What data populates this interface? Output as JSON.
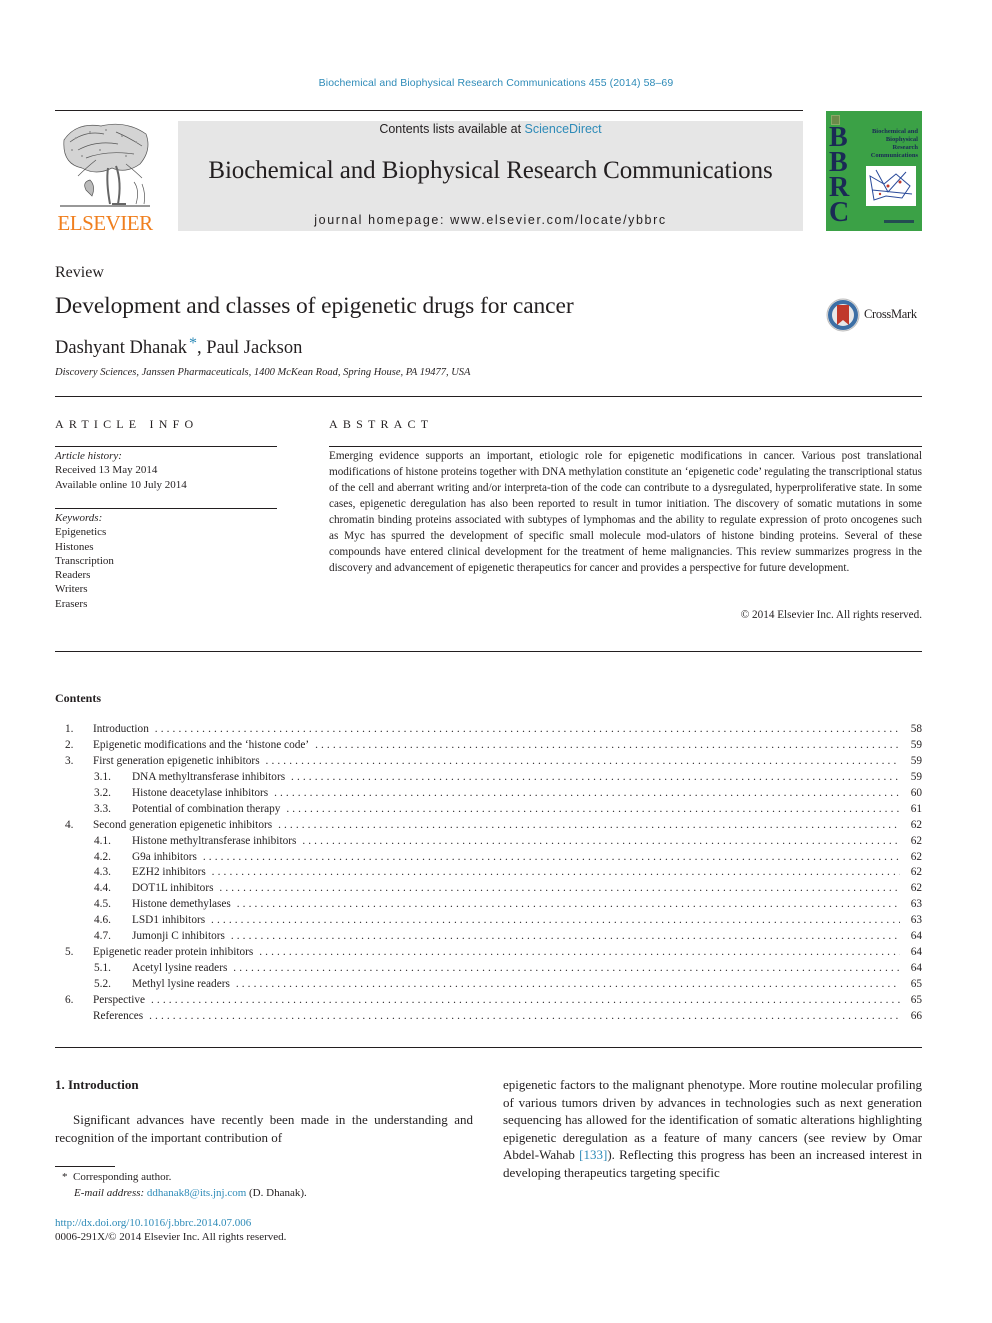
{
  "header": {
    "journal_ref": "Biochemical and Biophysical Research Communications 455 (2014) 58–69",
    "contents_prefix": "Contents lists available at ",
    "contents_link": "ScienceDirect",
    "journal_title": "Biochemical and Biophysical Research Communications",
    "homepage": "journal homepage: www.elsevier.com/locate/ybbrc",
    "publisher_wordmark": "ELSEVIER",
    "cover": {
      "letters": [
        "B",
        "B",
        "R",
        "C"
      ],
      "title_lines": [
        "Biochemical and",
        "Biophysical",
        "Research",
        "Communications"
      ],
      "background_color": "#3ba146"
    },
    "colors": {
      "link": "#2e8bb8",
      "elsevier_orange": "#f07f1e",
      "masthead_bg": "#e6e6e6"
    }
  },
  "article": {
    "type": "Review",
    "title": "Development and classes of epigenetic drugs for cancer",
    "crossmark_label": "CrossMark",
    "authors": {
      "first": "Dashyant Dhanak",
      "corresponding_mark": "*",
      "separator": ", ",
      "second": "Paul Jackson"
    },
    "affiliation": "Discovery Sciences, Janssen Pharmaceuticals, 1400 McKean Road, Spring House, PA 19477, USA"
  },
  "article_info": {
    "heading": "ARTICLE INFO",
    "history_label": "Article history:",
    "received": "Received 13 May 2014",
    "available": "Available online 10 July 2014",
    "keywords_label": "Keywords:",
    "keywords": [
      "Epigenetics",
      "Histones",
      "Transcription",
      "Readers",
      "Writers",
      "Erasers"
    ]
  },
  "abstract": {
    "heading": "ABSTRACT",
    "text": "Emerging evidence supports an important, etiologic role for epigenetic modifications in cancer. Various post translational modifications of histone proteins together with DNA methylation constitute an ‘epigenetic code’ regulating the transcriptional status of the cell and aberrant writing and/or interpreta-tion of the code can contribute to a dysregulated, hyperproliferative state. In some cases, epigenetic deregulation has also been reported to result in tumor initiation. The discovery of somatic mutations in some chromatin binding proteins associated with subtypes of lymphomas and the ability to regulate expression of proto oncogenes such as Myc has spurred the development of specific small molecule mod-ulators of histone binding proteins. Several of these compounds have entered clinical development for the treatment of heme malignancies. This review summarizes progress in the discovery and advancement of epigenetic therapeutics for cancer and provides a perspective for future development.",
    "copyright": "© 2014 Elsevier Inc. All rights reserved."
  },
  "contents": {
    "heading": "Contents",
    "items": [
      {
        "num": "1.",
        "title": "Introduction",
        "page": "58",
        "level": 1
      },
      {
        "num": "2.",
        "title": "Epigenetic modifications and the ‘histone code’",
        "page": "59",
        "level": 1
      },
      {
        "num": "3.",
        "title": "First generation epigenetic inhibitors",
        "page": "59",
        "level": 1
      },
      {
        "num": "3.1.",
        "title": "DNA methyltransferase inhibitors",
        "page": "59",
        "level": 2
      },
      {
        "num": "3.2.",
        "title": "Histone deacetylase inhibitors",
        "page": "60",
        "level": 2
      },
      {
        "num": "3.3.",
        "title": "Potential of combination therapy",
        "page": "61",
        "level": 2
      },
      {
        "num": "4.",
        "title": "Second generation epigenetic inhibitors",
        "page": "62",
        "level": 1
      },
      {
        "num": "4.1.",
        "title": "Histone methyltransferase inhibitors",
        "page": "62",
        "level": 2
      },
      {
        "num": "4.2.",
        "title": "G9a inhibitors",
        "page": "62",
        "level": 2
      },
      {
        "num": "4.3.",
        "title": "EZH2 inhibitors",
        "page": "62",
        "level": 2
      },
      {
        "num": "4.4.",
        "title": "DOT1L inhibitors",
        "page": "62",
        "level": 2
      },
      {
        "num": "4.5.",
        "title": "Histone demethylases",
        "page": "63",
        "level": 2
      },
      {
        "num": "4.6.",
        "title": "LSD1 inhibitors",
        "page": "63",
        "level": 2
      },
      {
        "num": "4.7.",
        "title": "Jumonji C inhibitors",
        "page": "64",
        "level": 2
      },
      {
        "num": "5.",
        "title": "Epigenetic reader protein inhibitors",
        "page": "64",
        "level": 1
      },
      {
        "num": "5.1.",
        "title": "Acetyl lysine readers",
        "page": "64",
        "level": 2
      },
      {
        "num": "5.2.",
        "title": "Methyl lysine readers",
        "page": "65",
        "level": 2
      },
      {
        "num": "6.",
        "title": "Perspective",
        "page": "65",
        "level": 1
      },
      {
        "num": "",
        "title": "References",
        "page": "66",
        "level": 1
      }
    ]
  },
  "body": {
    "section_heading": "1. Introduction",
    "left_paragraph": "Significant advances have recently been made in the understanding and recognition of the important contribution of",
    "right_paragraph_before_ref": "epigenetic factors to the malignant phenotype. More routine molecular profiling of various tumors driven by advances in technologies such as next generation sequencing has allowed for the identification of somatic alterations highlighting epigenetic deregulation as a feature of many cancers (see review by Omar Abdel-Wahab ",
    "right_paragraph_ref": "[133]",
    "right_paragraph_after_ref": "). Reflecting this progress has been an increased interest in developing therapeutics targeting specific"
  },
  "footnotes": {
    "corresponding_mark": "*",
    "corresponding_text": "Corresponding author.",
    "email_label": "E-mail address:",
    "email": "ddhanak8@its.jnj.com",
    "email_suffix": "(D. Dhanak).",
    "doi": "http://dx.doi.org/10.1016/j.bbrc.2014.07.006",
    "issn": "0006-291X/© 2014 Elsevier Inc. All rights reserved."
  }
}
